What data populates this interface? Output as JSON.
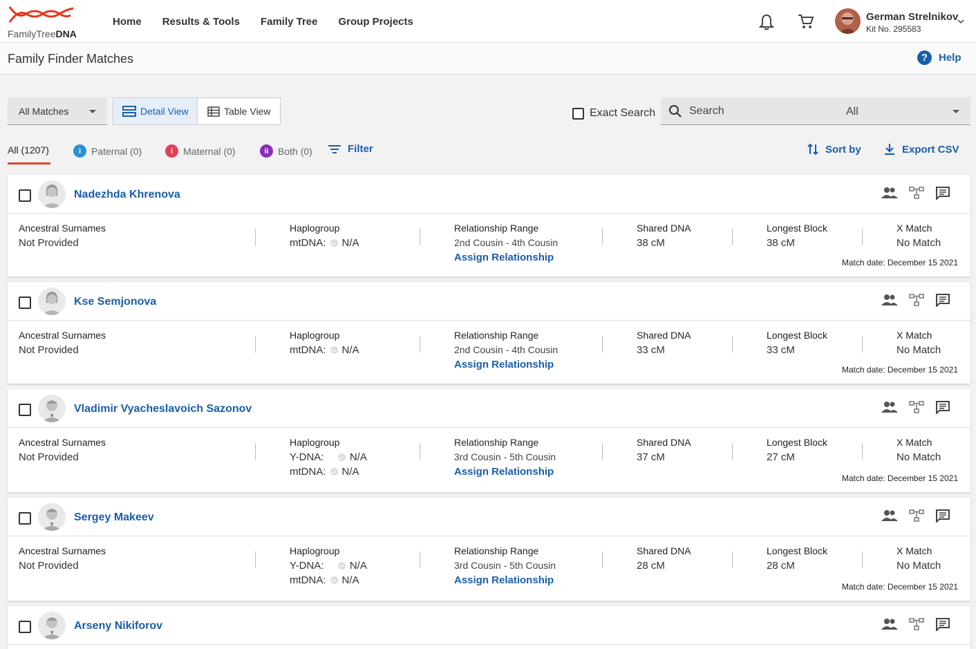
{
  "brand": {
    "logo_prefix": "FamilyTree",
    "logo_suffix": "DNA"
  },
  "nav": [
    "Home",
    "Results & Tools",
    "Family Tree",
    "Group Projects"
  ],
  "user": {
    "name": "German Strelnikov",
    "kit": "Kit No. 295583"
  },
  "page_title": "Family Finder Matches",
  "help_label": "Help",
  "toolbar": {
    "matches_select": "All Matches",
    "detail_view": "Detail View",
    "table_view": "Table View",
    "exact_search": "Exact Search",
    "search_placeholder": "Search",
    "search_scope": "All"
  },
  "tabs": {
    "all": "All (1207)",
    "paternal": "Paternal (0)",
    "maternal": "Maternal (0)",
    "both": "Both (0)",
    "filter": "Filter",
    "sort": "Sort by",
    "export": "Export CSV"
  },
  "colors": {
    "accent": "#1a5ea8",
    "paternal": "#2e8fd6",
    "maternal": "#e0405a",
    "both": "#8a2eb8",
    "underline": "#e0442a"
  },
  "labels": {
    "surnames": "Ancestral Surnames",
    "haplogroup": "Haplogroup",
    "relationship": "Relationship Range",
    "shared": "Shared DNA",
    "longest": "Longest Block",
    "xmatch": "X Match",
    "assign": "Assign Relationship",
    "ydna": "Y-DNA:",
    "mtdna": "mtDNA:"
  },
  "matches": [
    {
      "name": "Nadezhda Khrenova",
      "gender": "female",
      "surnames": "Not Provided",
      "ydna": null,
      "mtdna": "N/A",
      "range": "2nd Cousin - 4th Cousin",
      "shared": "38 cM",
      "longest": "38 cM",
      "x": "No Match",
      "date": "Match date: December 15 2021"
    },
    {
      "name": "Kse Semjonova",
      "gender": "female",
      "surnames": "Not Provided",
      "ydna": null,
      "mtdna": "N/A",
      "range": "2nd Cousin - 4th Cousin",
      "shared": "33 cM",
      "longest": "33 cM",
      "x": "No Match",
      "date": "Match date: December 15 2021"
    },
    {
      "name": "Vladimir Vyacheslavoich Sazonov",
      "gender": "male",
      "surnames": "Not Provided",
      "ydna": "N/A",
      "mtdna": "N/A",
      "range": "3rd Cousin - 5th Cousin",
      "shared": "37 cM",
      "longest": "27 cM",
      "x": "No Match",
      "date": "Match date: December 15 2021"
    },
    {
      "name": "Sergey Makeev",
      "gender": "male",
      "surnames": "Not Provided",
      "ydna": "N/A",
      "mtdna": "N/A",
      "range": "3rd Cousin - 5th Cousin",
      "shared": "28 cM",
      "longest": "28 cM",
      "x": "No Match",
      "date": "Match date: December 15 2021"
    },
    {
      "name": "Arseny Nikiforov",
      "gender": "male",
      "surnames": "",
      "ydna": null,
      "mtdna": null,
      "range": "",
      "shared": "",
      "longest": "",
      "x": "",
      "date": ""
    }
  ]
}
